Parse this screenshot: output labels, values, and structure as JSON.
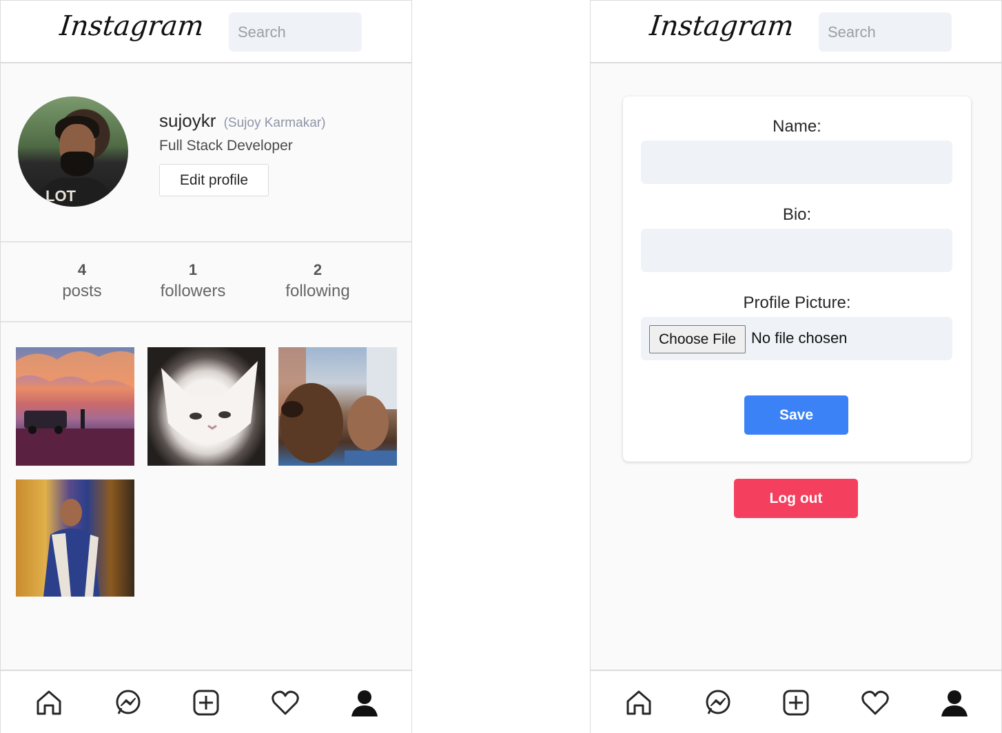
{
  "brand": {
    "logo_text": "Instagram"
  },
  "search": {
    "placeholder": "Search"
  },
  "profile": {
    "username": "sujoykr",
    "full_name": "(Sujoy Karmakar)",
    "bio": "Full Stack Developer",
    "edit_button": "Edit profile",
    "avatar_shirt_text": "LOT"
  },
  "stats": [
    {
      "count": "4",
      "label": "posts"
    },
    {
      "count": "1",
      "label": "followers"
    },
    {
      "count": "2",
      "label": "following"
    }
  ],
  "posts": [
    {
      "subject": "sunset landscape with jeep"
    },
    {
      "subject": "white cat"
    },
    {
      "subject": "dog with man"
    },
    {
      "subject": "man in traditional dress"
    }
  ],
  "edit_form": {
    "name_label": "Name:",
    "bio_label": "Bio:",
    "picture_label": "Profile Picture:",
    "choose_file": "Choose File",
    "no_file": "No file chosen",
    "save": "Save",
    "logout": "Log out"
  },
  "bottom_nav": [
    "home-icon",
    "messenger-icon",
    "add-post-icon",
    "heart-icon",
    "profile-icon"
  ],
  "colors": {
    "save": "#3b82f6",
    "logout": "#f43f5e",
    "input_bg": "#eff2f6",
    "page_bg": "#fafafa"
  }
}
